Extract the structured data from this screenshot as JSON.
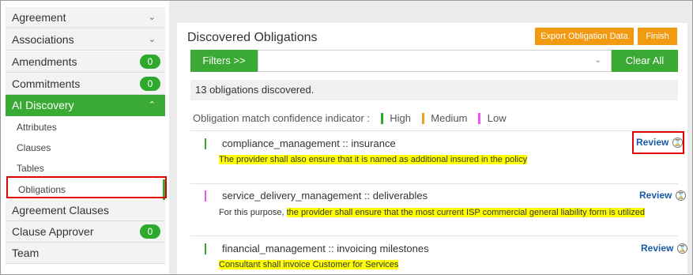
{
  "colors": {
    "green": "#3aaa35",
    "orange": "#f19a12",
    "high": "#2daa2d",
    "medium": "#f0a020",
    "low": "#ee55ee",
    "highlight": "#ffff00",
    "review_link": "#1a5aa8"
  },
  "sidebar": {
    "items": [
      {
        "label": "Agreement",
        "icon": "chevron-down-icon"
      },
      {
        "label": "Associations",
        "icon": "chevron-down-icon"
      },
      {
        "label": "Amendments",
        "badge": "0"
      },
      {
        "label": "Commitments",
        "badge": "0"
      },
      {
        "label": "AI Discovery",
        "icon": "chevron-up-icon",
        "active": true
      },
      {
        "label": "Agreement Clauses"
      },
      {
        "label": "Clause Approver",
        "badge": "0"
      },
      {
        "label": "Team"
      }
    ],
    "ai_discovery_subitems": [
      "Attributes",
      "Clauses",
      "Tables",
      "Obligations"
    ],
    "selected_subitem": "Obligations"
  },
  "header": {
    "title": "Discovered Obligations",
    "export_label": "Export Obligation Data",
    "finish_label": "Finish"
  },
  "filters": {
    "button_label": "Filters >>",
    "clear_label": "Clear All"
  },
  "count_text": "13 obligations discovered.",
  "legend": {
    "label": "Obligation match confidence indicator :",
    "high": "High",
    "medium": "Medium",
    "low": "Low"
  },
  "obligations": [
    {
      "title": "compliance_management :: insurance",
      "confidence": "High",
      "prefix": "",
      "highlight": "The provider shall also ensure that it is named as additional insured in the policy",
      "review_label": "Review"
    },
    {
      "title": "service_delivery_management :: deliverables",
      "confidence": "Low",
      "prefix": "For this purpose, ",
      "highlight": "the provider shall ensure that the most current ISP commercial general liability form is utilized",
      "review_label": "Review"
    },
    {
      "title": "financial_management :: invoicing milestones",
      "confidence": "High",
      "prefix": "",
      "highlight": "Consultant shall invoice Customer for Services",
      "review_label": "Review"
    }
  ]
}
